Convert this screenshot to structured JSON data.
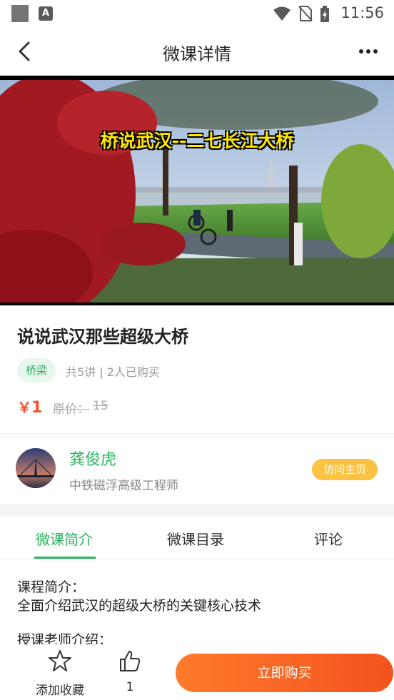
{
  "status_bar": {
    "time": "11:56",
    "icons": [
      "square-icon",
      "font-a-icon",
      "wifi-icon",
      "no-sim-icon",
      "battery-charging-icon"
    ]
  },
  "header": {
    "title": "微课详情",
    "back_icon": "back-arrow-icon",
    "more_icon": "more-dots-icon"
  },
  "video": {
    "caption": "桥说武汉--二七长江大桥"
  },
  "course": {
    "title": "说说武汉那些超级大桥",
    "tag": "桥梁",
    "meta": "共5讲 | 2人已购买",
    "price_symbol": "￥",
    "price": "1",
    "original_price_label": "原价：",
    "original_price": "15"
  },
  "teacher": {
    "name": "龚俊虎",
    "title": "中铁磁浮高级工程师",
    "visit_button": "访问主页"
  },
  "tabs": [
    {
      "label": "微课简介",
      "active": true
    },
    {
      "label": "微课目录",
      "active": false
    },
    {
      "label": "评论",
      "active": false
    }
  ],
  "content": {
    "intro_heading": "课程简介：",
    "intro_text": "全面介绍武汉的超级大桥的关键核心技术",
    "teacher_heading": "授课老师介绍："
  },
  "bottom_bar": {
    "favorite_label": "添加收藏",
    "like_count": "1",
    "buy_button": "立即购买"
  },
  "colors": {
    "accent_green": "#2db35f",
    "price_red": "#f44f2d",
    "visit_button": "#fbc344",
    "buy_gradient_start": "#ff7a2c",
    "buy_gradient_end": "#f4521e"
  }
}
